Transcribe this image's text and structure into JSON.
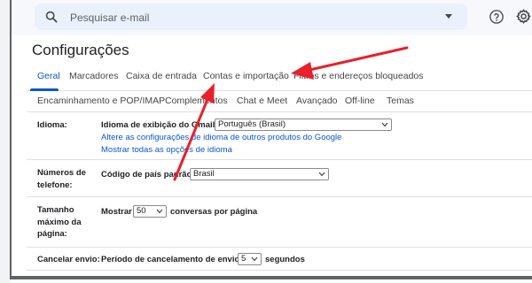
{
  "search": {
    "placeholder": "Pesquisar e-mail"
  },
  "page": {
    "title": "Configurações"
  },
  "tabs_primary": [
    {
      "label": "Geral",
      "active": true
    },
    {
      "label": "Marcadores"
    },
    {
      "label": "Caixa de entrada"
    },
    {
      "label": "Contas e importação"
    },
    {
      "label": "Filtros e endereços bloqueados"
    }
  ],
  "tabs_secondary": [
    {
      "label": "Encaminhamento e POP/IMAP"
    },
    {
      "label": "Complementos"
    },
    {
      "label": "Chat e Meet"
    },
    {
      "label": "Avançado"
    },
    {
      "label": "Off-line"
    },
    {
      "label": "Temas"
    }
  ],
  "settings": {
    "language": {
      "section": "Idioma:",
      "field_label": "Idioma de exibição do Gmail:",
      "selected": "Português (Brasil)",
      "link_1": "Altere as configurações de idioma de outros produtos do Google",
      "link_2": "Mostrar todas as opções de idioma"
    },
    "phone": {
      "section_line1": "Números de",
      "section_line2": "telefone:",
      "field_label": "Código de país padrão:",
      "selected": "Brasil"
    },
    "page_size": {
      "section_line1": "Tamanho",
      "section_line2": "máximo da",
      "section_line3": "página:",
      "prefix": "Mostrar",
      "selected": "50",
      "suffix": "conversas por página"
    },
    "undo_send": {
      "section": "Cancelar envio:",
      "field_label": "Período de cancelamento de envio:",
      "selected": "5",
      "suffix": "segundos"
    }
  },
  "colors": {
    "accent": "#0b57d0",
    "annotation_arrow": "#e8212a"
  }
}
